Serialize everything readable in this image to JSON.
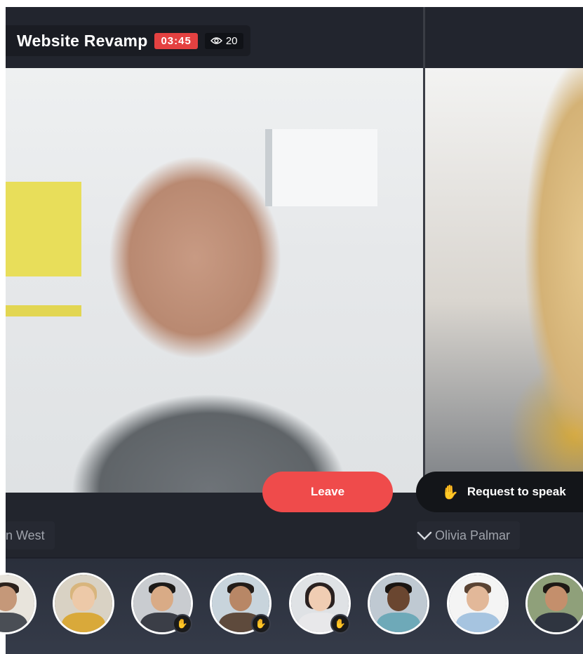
{
  "meeting": {
    "title": "Website Revamp",
    "timer": "03:45",
    "viewer_count": "20",
    "viewer_icon": "eye-icon"
  },
  "controls": {
    "leave_label": "Leave",
    "request_label": "Request to speak",
    "request_icon": "raised-hand-icon"
  },
  "speakers": [
    {
      "name": "n West"
    },
    {
      "name": "Olivia Palmar",
      "icon": "chevron-down-icon"
    }
  ],
  "participants": [
    {
      "hand_raised": false
    },
    {
      "hand_raised": false
    },
    {
      "hand_raised": true
    },
    {
      "hand_raised": true
    },
    {
      "hand_raised": true
    },
    {
      "hand_raised": false
    },
    {
      "hand_raised": false
    },
    {
      "hand_raised": false
    }
  ],
  "colors": {
    "accent_red": "#ef4b4b",
    "background": "#1d2029"
  }
}
